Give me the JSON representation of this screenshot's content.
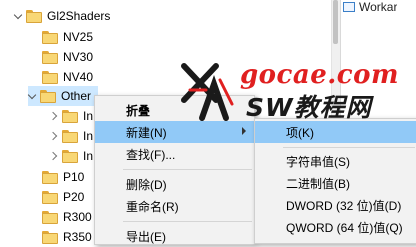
{
  "tree": {
    "items": [
      {
        "label": "Gl2Shaders",
        "expanded": true
      },
      {
        "label": "NV25"
      },
      {
        "label": "NV30"
      },
      {
        "label": "NV40"
      },
      {
        "label": "Other",
        "expanded": true,
        "selected": true
      },
      {
        "label": "In"
      },
      {
        "label": "In"
      },
      {
        "label": "In"
      },
      {
        "label": "P10"
      },
      {
        "label": "P20"
      },
      {
        "label": "R300"
      },
      {
        "label": "R350"
      }
    ]
  },
  "value_pane": {
    "first_value": "Workar"
  },
  "context_menu": {
    "items": [
      {
        "label": "折叠"
      },
      {
        "label": "新建(N)"
      },
      {
        "label": "查找(F)..."
      },
      {
        "label": "删除(D)"
      },
      {
        "label": "重命名(R)"
      },
      {
        "label": "导出(E)"
      }
    ]
  },
  "submenu": {
    "items": [
      {
        "label": "项(K)"
      },
      {
        "label": "字符串值(S)"
      },
      {
        "label": "二进制值(B)"
      },
      {
        "label": "DWORD (32 位)值(D)"
      },
      {
        "label": "QWORD (64 位)值(Q)"
      }
    ]
  },
  "watermark": {
    "site": "gocae.com",
    "brand": "SW教程网",
    "logo_letters": "XAV"
  },
  "colors": {
    "selection": "#cde8ff",
    "menu_highlight": "#91c9f7",
    "watermark_red": "#e02020",
    "watermark_dark": "#1a1a1a"
  }
}
